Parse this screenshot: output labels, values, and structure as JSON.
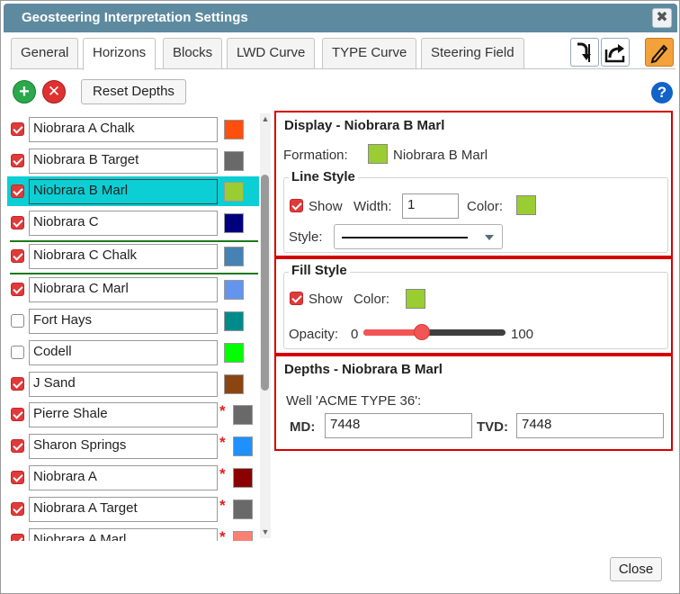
{
  "dialog": {
    "title": "Geosteering Interpretation Settings",
    "close_glyph": "✖"
  },
  "tabs": [
    {
      "label": "General"
    },
    {
      "label": "Horizons",
      "active": true
    },
    {
      "label": "Blocks"
    },
    {
      "label": "LWD Curve"
    },
    {
      "label": "TYPE Curve"
    },
    {
      "label": "Steering Field"
    }
  ],
  "toolbar": {
    "icons": [
      "import-icon",
      "export-share-icon",
      "edit-pencil-icon"
    ],
    "add_glyph": "+",
    "remove_glyph": "✕",
    "reset_label": "Reset Depths",
    "help_glyph": "?"
  },
  "horizons": [
    {
      "name": "Niobrara A Chalk",
      "checked": true,
      "color": "#ff4f0f",
      "required": false
    },
    {
      "name": "Niobrara B Target",
      "checked": true,
      "color": "#696969",
      "required": false
    },
    {
      "name": "Niobrara B Marl",
      "checked": true,
      "color": "#9acd32",
      "required": false,
      "selected": true
    },
    {
      "name": "Niobrara C",
      "checked": true,
      "color": "#00007f",
      "required": false
    },
    {
      "name": "Niobrara C Chalk",
      "checked": true,
      "color": "#4682b4",
      "required": false
    },
    {
      "name": "Niobrara C Marl",
      "checked": true,
      "color": "#6495ed",
      "required": false
    },
    {
      "name": "Fort Hays",
      "checked": false,
      "color": "#008b8b",
      "required": false
    },
    {
      "name": "Codell",
      "checked": false,
      "color": "#00ff00",
      "required": false
    },
    {
      "name": "J Sand",
      "checked": true,
      "color": "#8b4513",
      "required": false
    },
    {
      "name": "Pierre Shale",
      "checked": true,
      "color": "#696969",
      "required": true
    },
    {
      "name": "Sharon Springs",
      "checked": true,
      "color": "#1e90ff",
      "required": true
    },
    {
      "name": "Niobrara A",
      "checked": true,
      "color": "#8b0000",
      "required": true
    },
    {
      "name": "Niobrara A Target",
      "checked": true,
      "color": "#696969",
      "required": true
    },
    {
      "name": "Niobrara A Marl",
      "checked": true,
      "color": "#fa8072",
      "required": true
    }
  ],
  "required_marker": "*",
  "display": {
    "title": "Display - Niobrara B Marl",
    "formation_label": "Formation:",
    "formation_name": "Niobrara B Marl",
    "formation_color": "#9acd32",
    "line_style": {
      "legend": "Line Style",
      "show_label": "Show",
      "show_checked": true,
      "width_label": "Width:",
      "width_value": "1",
      "color_label": "Color:",
      "color": "#9acd32",
      "style_label": "Style:",
      "style_value": "solid"
    }
  },
  "fill_style": {
    "legend": "Fill Style",
    "show_label": "Show",
    "show_checked": true,
    "color_label": "Color:",
    "color": "#9acd32",
    "opacity_label": "Opacity:",
    "opacity_min": "0",
    "opacity_max": "100",
    "opacity_value": 40
  },
  "depths": {
    "title": "Depths - Niobrara B Marl",
    "well_label": "Well 'ACME TYPE 36':",
    "md_label": "MD:",
    "md_value": "7448",
    "tvd_label": "TVD:",
    "tvd_value": "7448"
  },
  "footer": {
    "close_label": "Close"
  }
}
